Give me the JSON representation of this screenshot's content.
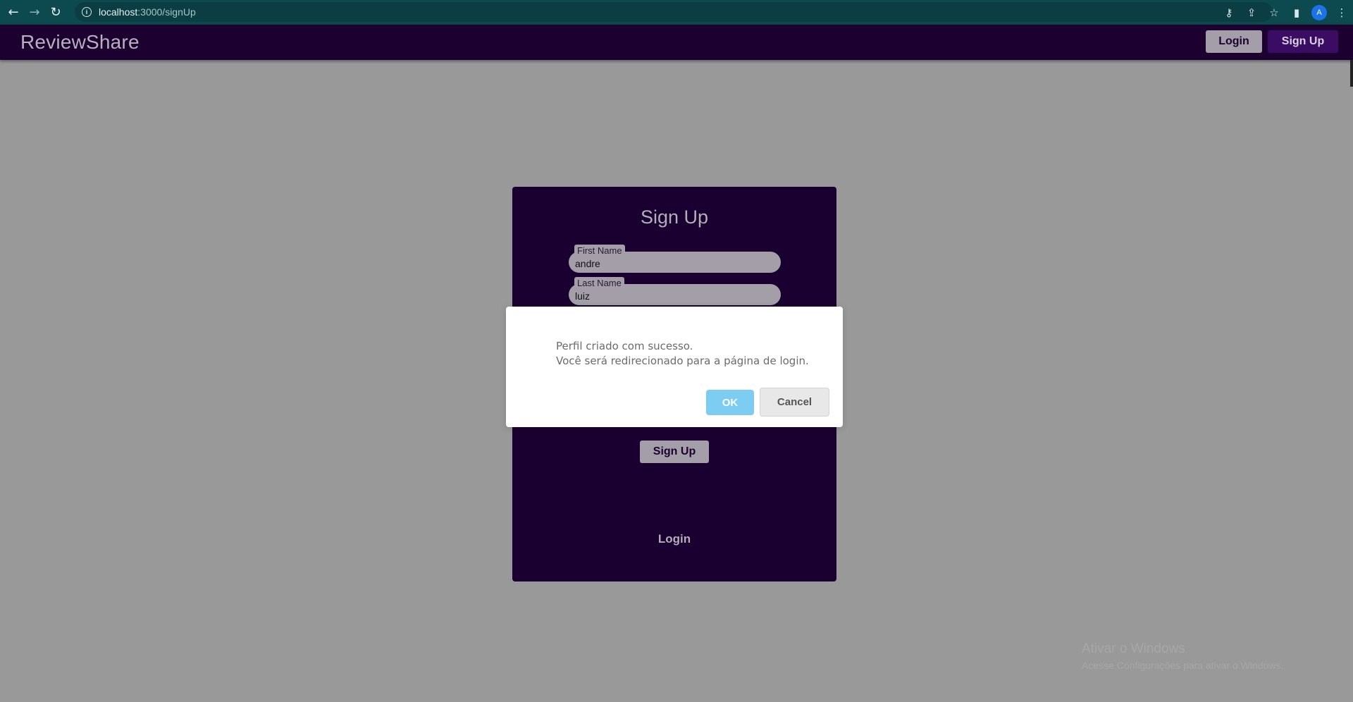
{
  "browser": {
    "url_host": "localhost",
    "url_path": ":3000/signUp",
    "profile_initial": "A",
    "icons": [
      "arrow-left-icon",
      "arrow-right-icon",
      "reload-icon",
      "info-icon",
      "key-icon",
      "share-icon",
      "star-icon",
      "sidepanel-icon",
      "more-vert-icon"
    ]
  },
  "navbar": {
    "brand": "ReviewShare",
    "login_label": "Login",
    "signup_label": "Sign Up"
  },
  "card": {
    "title": "Sign Up",
    "fields": [
      {
        "label": "First Name",
        "value": "andre"
      },
      {
        "label": "Last Name",
        "value": "luiz"
      }
    ],
    "submit_label": "Sign Up",
    "login_link": "Login"
  },
  "dialog": {
    "line1": "Perfil criado com sucesso.",
    "line2": "Você será redirecionado para a página de login.",
    "ok_label": "OK",
    "cancel_label": "Cancel"
  },
  "watermark": {
    "title": "Ativar o Windows",
    "subtitle": "Acesse Configurações para ativar o Windows."
  },
  "colors": {
    "chrome": "#0d4a4f",
    "navbar": "#1c0030",
    "card": "#1a0030",
    "backdrop": "#999999",
    "ok_button": "#7dcdf3"
  }
}
